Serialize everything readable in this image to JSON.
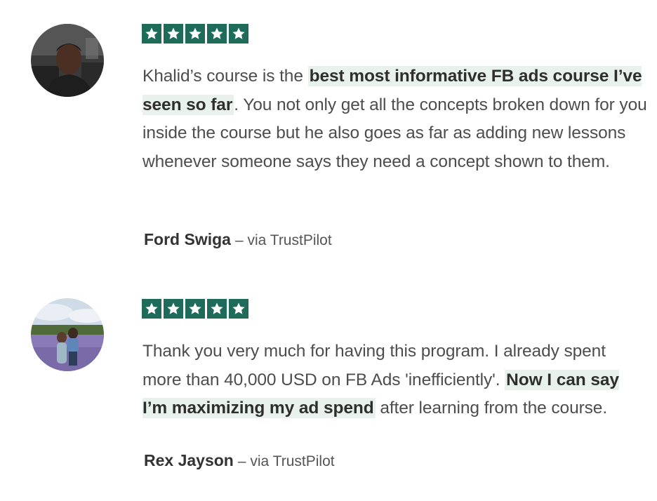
{
  "star_color": "#1f6b5a",
  "highlight_color": "#e8f1ec",
  "reviews": [
    {
      "rating": 5,
      "text_before": "Khalid’s course is the ",
      "highlight": "best most informative FB ads course I’ve seen so far",
      "text_after": ". You not only get all the concepts broken down for you inside the course but he also goes as far as adding new lessons whenever someone says they need a concept shown to them.",
      "author": "Ford Swiga",
      "source": "– via TrustPilot",
      "avatar_icon": "profile-photo-man-in-car"
    },
    {
      "rating": 5,
      "text_before": "Thank you very much for having this program. I already spent more than 40,000 USD on FB Ads 'inefficiently'. ",
      "highlight": "Now I can say I’m maximizing my ad spend",
      "text_after": " after learning from the course.",
      "author": "Rex Jayson",
      "source": "– via TrustPilot",
      "avatar_icon": "profile-photo-couple-lavender-field"
    }
  ]
}
